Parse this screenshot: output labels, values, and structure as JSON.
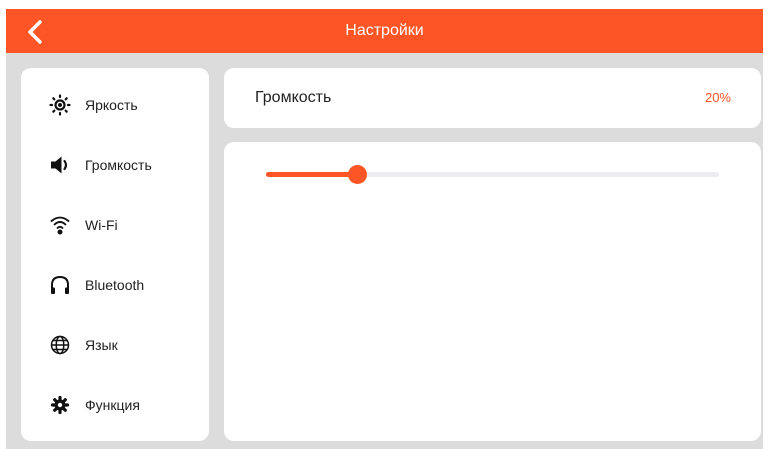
{
  "header": {
    "title": "Настройки",
    "back_icon": "chevron-left-icon"
  },
  "sidebar": {
    "items": [
      {
        "label": "Яркость",
        "icon": "brightness-icon"
      },
      {
        "label": "Громкость",
        "icon": "speaker-icon"
      },
      {
        "label": "Wi-Fi",
        "icon": "wifi-icon"
      },
      {
        "label": "Bluetooth",
        "icon": "headphones-icon"
      },
      {
        "label": "Язык",
        "icon": "globe-icon"
      },
      {
        "label": "Функция",
        "icon": "gear-icon"
      }
    ]
  },
  "volume": {
    "title": "Громкость",
    "value_text": "20%",
    "level": 0.2
  },
  "colors": {
    "accent": "#fe5526",
    "background": "#dcdcdc",
    "track": "#ececf1"
  }
}
